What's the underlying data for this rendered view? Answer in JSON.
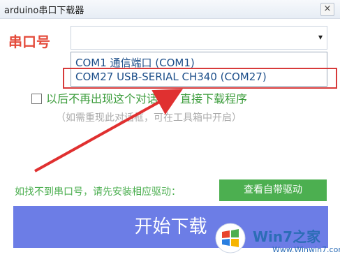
{
  "window": {
    "title": "arduino串口下载器",
    "close_label": "×"
  },
  "port": {
    "label": "串口号",
    "arrow": "▾",
    "options": [
      "COM1 通信端口 (COM1)",
      "COM27 USB-SERIAL CH340 (COM27)"
    ],
    "highlight_color": "#d73a3a"
  },
  "option": {
    "checkbox_label": "以后不再出现这个对话框，直接下载程序",
    "hint": "（如需重现此对话框，可在工具箱中开启）"
  },
  "driver": {
    "text": "如找不到串口号，请先安装相应驱动：",
    "button_label": "查看自带驱动",
    "color": "#4caf50"
  },
  "download": {
    "button_label": "开始下载",
    "color": "#6c7de6"
  },
  "watermark": {
    "text": "Win7之家",
    "url": "Www.Winwin7.com"
  },
  "annotation": {
    "arrow_color": "#e03030"
  }
}
